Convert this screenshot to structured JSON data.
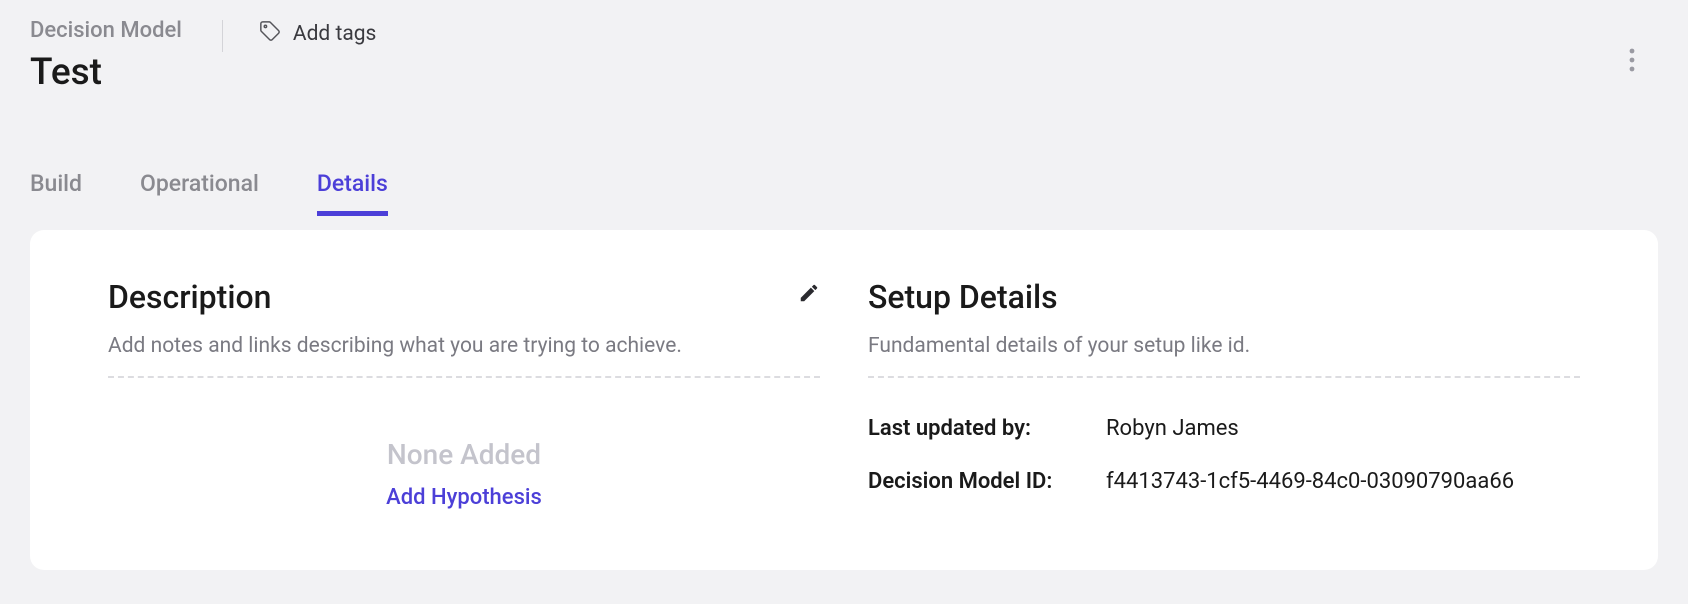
{
  "header": {
    "breadcrumb": "Decision Model",
    "title": "Test",
    "add_tags_label": "Add tags"
  },
  "tabs": {
    "build": "Build",
    "operational": "Operational",
    "details": "Details"
  },
  "description": {
    "title": "Description",
    "subtitle": "Add notes and links describing what you are trying to achieve.",
    "empty": "None Added",
    "add_hypothesis": "Add Hypothesis"
  },
  "setup": {
    "title": "Setup Details",
    "subtitle": "Fundamental details of your setup like id.",
    "rows": [
      {
        "label": "Last updated by:",
        "value": "Robyn James"
      },
      {
        "label": "Decision Model ID:",
        "value": "f4413743-1cf5-4469-84c0-03090790aa66"
      }
    ]
  }
}
